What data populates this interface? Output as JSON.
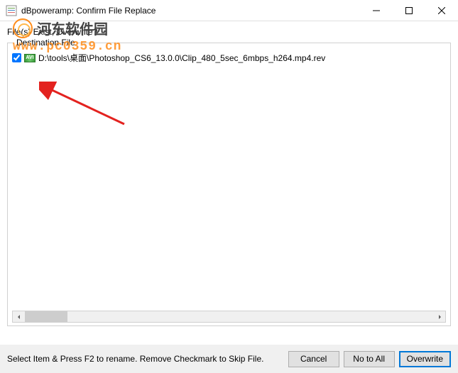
{
  "window": {
    "title": "dBpoweramp: Confirm File Replace"
  },
  "prompt": "File(s) Exist, Overwrite?",
  "group": {
    "label": "Destination File",
    "items": [
      {
        "checked": true,
        "icon": "AVI",
        "path": "D:\\tools\\桌面\\Photoshop_CS6_13.0.0\\Clip_480_5sec_6mbps_h264.mp4.rev"
      }
    ]
  },
  "hint": "Select Item & Press F2 to rename. Remove Checkmark to Skip File.",
  "buttons": {
    "cancel": "Cancel",
    "no_all": "No to All",
    "overwrite": "Overwrite"
  },
  "watermark": {
    "cn": "河东软件园",
    "url": "www.pc0359.cn"
  }
}
